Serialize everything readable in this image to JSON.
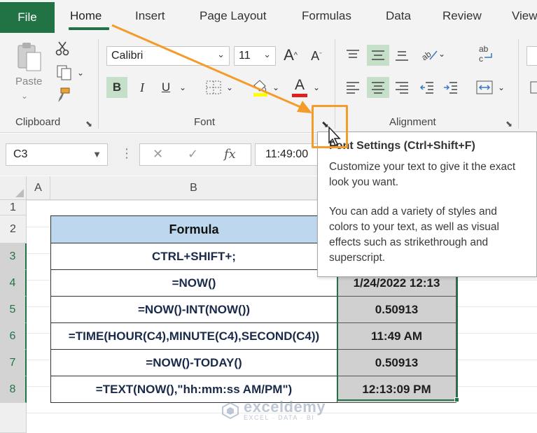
{
  "ribbon": {
    "tabs": [
      "File",
      "Home",
      "Insert",
      "Page Layout",
      "Formulas",
      "Data",
      "Review",
      "View"
    ],
    "clipboard": {
      "paste_label": "Paste",
      "group_label": "Clipboard"
    },
    "font": {
      "family": "Calibri",
      "size": "11",
      "bold": "B",
      "italic": "I",
      "underline": "U",
      "grow": "A",
      "shrink": "A",
      "font_color": "A",
      "group_label": "Font"
    },
    "alignment": {
      "group_label": "Alignment"
    }
  },
  "formula_bar": {
    "name_box": "C3",
    "cancel": "✕",
    "enter": "✓",
    "fx": "fx",
    "value": "11:49:00"
  },
  "sheet": {
    "columns": [
      "A",
      "B"
    ],
    "rows": [
      "1",
      "2",
      "3",
      "4",
      "5",
      "6",
      "7",
      "8"
    ],
    "header": "Formula",
    "formulas": [
      "CTRL+SHIFT+;",
      "=NOW()",
      "=NOW()-INT(NOW())",
      "=TIME(HOUR(C4),MINUTE(C4),SECOND(C4))",
      "=NOW()-TODAY()",
      "=TEXT(NOW(),\"hh:mm:ss AM/PM\")"
    ],
    "results": [
      "",
      "1/24/2022 12:13",
      "0.50913",
      "11:49 AM",
      "0.50913",
      "12:13:09 PM"
    ]
  },
  "tooltip": {
    "title": "Font Settings (Ctrl+Shift+F)",
    "p1": "Customize your text to give it the exact look you want.",
    "p2": "You can add a variety of styles and colors to your text, as well as visual effects such as strikethrough and superscript."
  },
  "watermark": {
    "name": "exceldemy",
    "sub": "EXCEL · DATA · BI"
  },
  "colors": {
    "excel_green": "#217346",
    "header_blue": "#bdd7ee",
    "highlight_orange": "#f39c29"
  }
}
